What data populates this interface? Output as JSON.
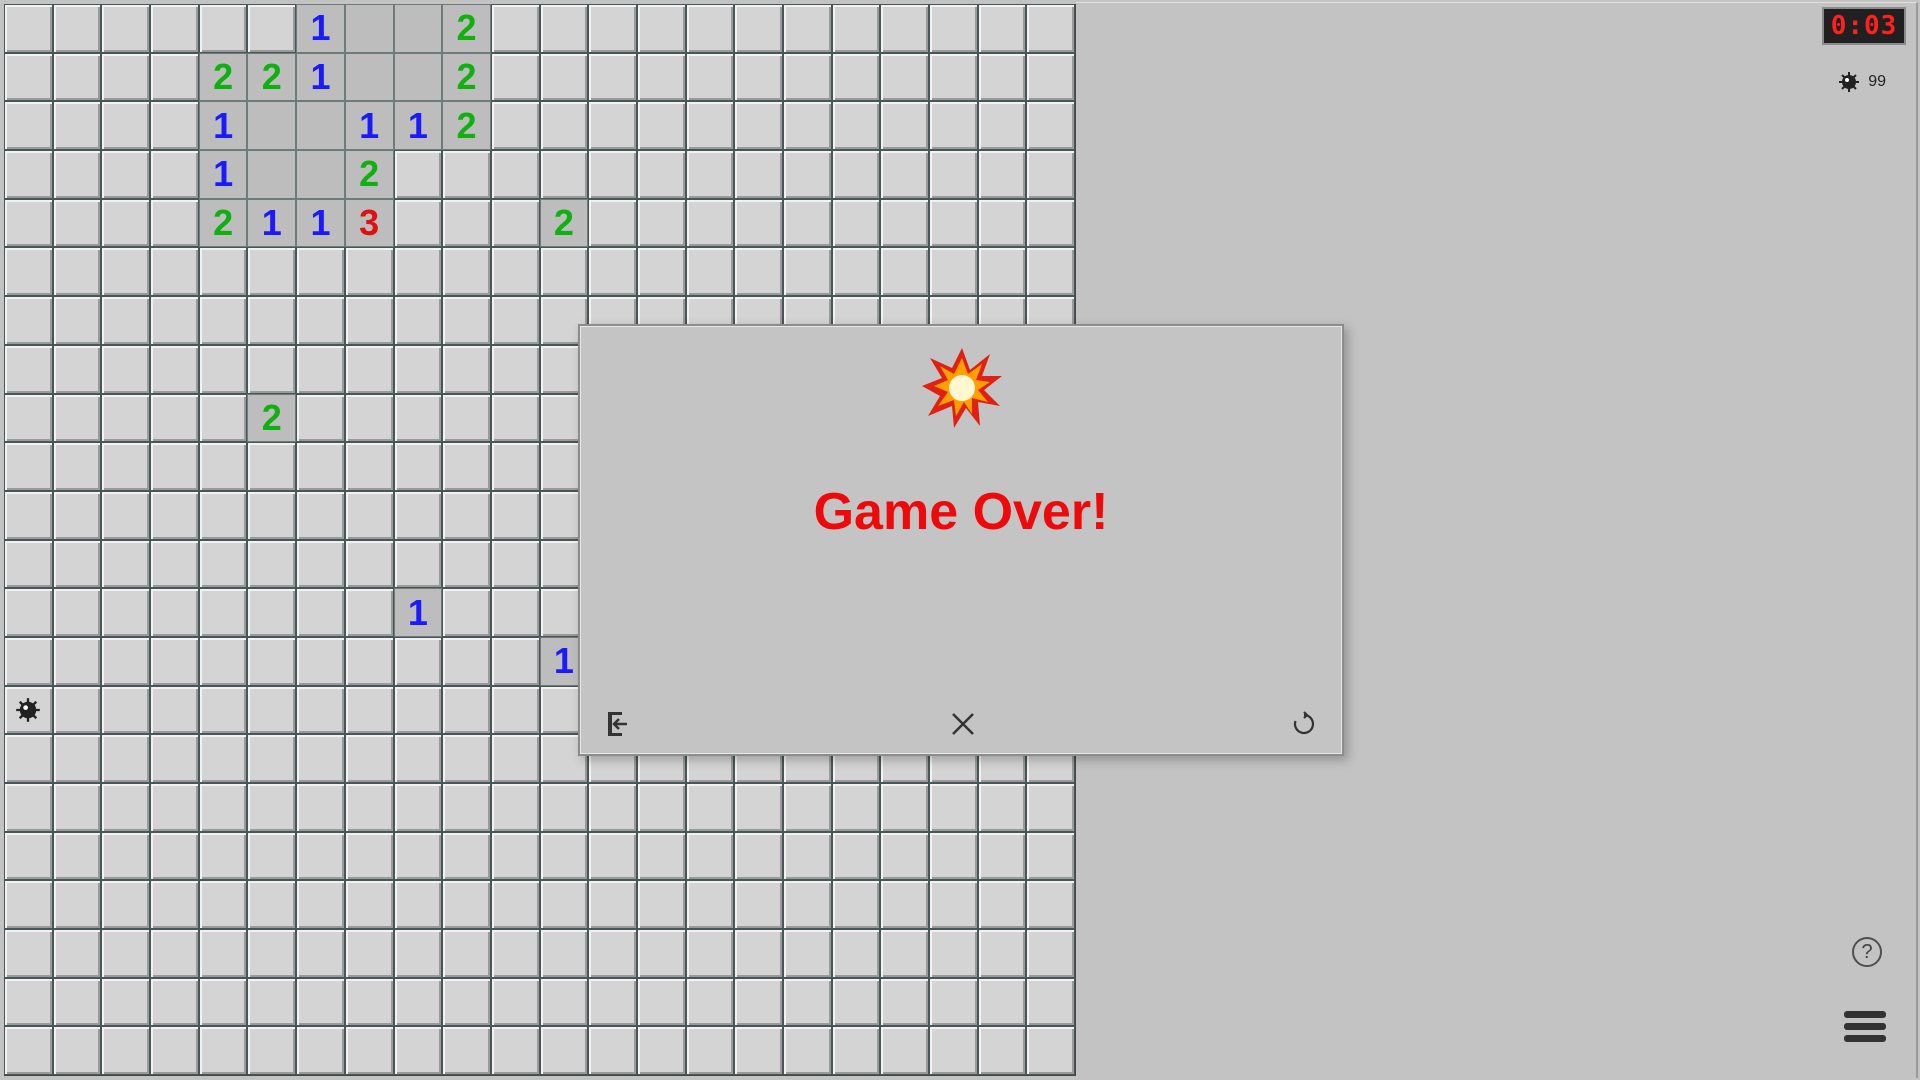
{
  "board": {
    "rows": 22,
    "cols": 22,
    "revealed": [
      [
        0,
        6,
        "1"
      ],
      [
        0,
        7,
        ""
      ],
      [
        0,
        8,
        ""
      ],
      [
        0,
        9,
        "2"
      ],
      [
        1,
        4,
        "2"
      ],
      [
        1,
        5,
        "2"
      ],
      [
        1,
        6,
        "1"
      ],
      [
        1,
        7,
        ""
      ],
      [
        1,
        8,
        ""
      ],
      [
        1,
        9,
        "2"
      ],
      [
        2,
        4,
        "1"
      ],
      [
        2,
        5,
        ""
      ],
      [
        2,
        6,
        ""
      ],
      [
        2,
        7,
        "1"
      ],
      [
        2,
        8,
        "1"
      ],
      [
        2,
        9,
        "2"
      ],
      [
        3,
        4,
        "1"
      ],
      [
        3,
        5,
        ""
      ],
      [
        3,
        6,
        ""
      ],
      [
        3,
        7,
        "2"
      ],
      [
        4,
        4,
        "2"
      ],
      [
        4,
        5,
        "1"
      ],
      [
        4,
        6,
        "1"
      ],
      [
        4,
        7,
        "3"
      ],
      [
        4,
        11,
        "2"
      ],
      [
        8,
        5,
        "2"
      ],
      [
        12,
        8,
        "1"
      ],
      [
        13,
        11,
        "1"
      ]
    ],
    "mines": [
      [
        14,
        0
      ]
    ],
    "colors": {
      "1": "#1a1aff",
      "2": "#10b010",
      "3": "#e01010"
    }
  },
  "timer": "0:03",
  "mines_remaining": "99",
  "dialog": {
    "title": "Game Over!",
    "icons": [
      "explosion-icon",
      "exit-icon",
      "close-icon",
      "restart-icon"
    ]
  },
  "controls": {
    "help_symbol": "?",
    "menu_icon": "hamburger-menu-icon"
  }
}
